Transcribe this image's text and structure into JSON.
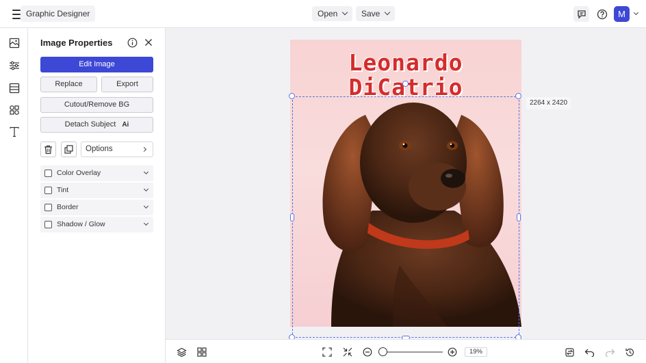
{
  "topbar": {
    "app_title": "Graphic Designer",
    "open_label": "Open",
    "save_label": "Save",
    "avatar_initial": "M"
  },
  "panel": {
    "title": "Image Properties",
    "edit_image": "Edit Image",
    "replace": "Replace",
    "export": "Export",
    "cutout": "Cutout/Remove BG",
    "detach_subject": "Detach Subject",
    "detach_badge": "Ai",
    "options": "Options",
    "accordions": [
      {
        "label": "Color Overlay"
      },
      {
        "label": "Tint"
      },
      {
        "label": "Border"
      },
      {
        "label": "Shadow / Glow"
      }
    ]
  },
  "canvas": {
    "art_title_line1": "Leonardo",
    "art_title_line2": "DiCatrio",
    "dimensions": "2264 x 2420"
  },
  "bottom": {
    "zoom_value": "19%",
    "zoom_level": 0.19
  },
  "colors": {
    "accent": "#3d48d6",
    "selection": "#5a73e8",
    "art_title": "#d42c2c",
    "art_background": "#f8d3d3"
  }
}
